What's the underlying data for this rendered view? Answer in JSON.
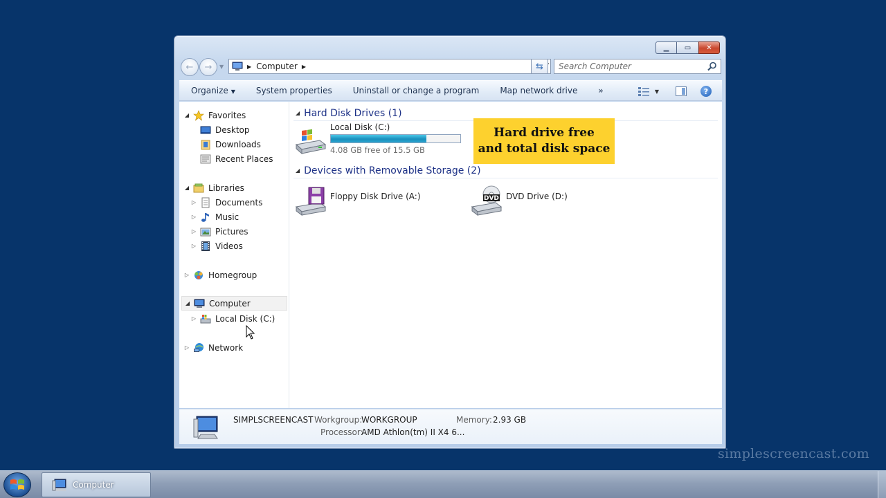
{
  "window": {
    "caption_buttons": [
      "minimize-icon",
      "maximize-icon",
      "close-icon"
    ]
  },
  "navigation": {
    "back_icon": "back-arrow-icon",
    "forward_icon": "forward-arrow-icon",
    "breadcrumb": [
      "Computer"
    ],
    "search_placeholder": "Search Computer"
  },
  "toolbar": {
    "organize_label": "Organize",
    "system_properties_label": "System properties",
    "uninstall_label": "Uninstall or change a program",
    "map_drive_label": "Map network drive",
    "more_label": "»"
  },
  "nav_pane": {
    "favorites": "Favorites",
    "desktop": "Desktop",
    "downloads": "Downloads",
    "recent_places": "Recent Places",
    "libraries": "Libraries",
    "documents": "Documents",
    "music": "Music",
    "pictures": "Pictures",
    "videos": "Videos",
    "homegroup": "Homegroup",
    "computer": "Computer",
    "local_disk": "Local Disk (C:)",
    "network": "Network"
  },
  "main": {
    "hard_disk_group": "Hard Disk Drives (1)",
    "removable_group": "Devices with Removable Storage (2)",
    "local_disk_name": "Local Disk (C:)",
    "local_disk_free": "4.08 GB free of 15.5 GB",
    "local_disk_used_fraction": 0.737,
    "floppy_name": "Floppy Disk Drive (A:)",
    "dvd_name": "DVD Drive (D:)",
    "dvd_badge": "DVD"
  },
  "callout": {
    "line1": "Hard drive free",
    "line2": "and total disk space"
  },
  "details": {
    "computer_name": "SIMPLSCREENCAST",
    "workgroup_label": "Workgroup:",
    "workgroup_value": "WORKGROUP",
    "memory_label": "Memory:",
    "memory_value": "2.93 GB",
    "processor_label": "Processor:",
    "processor_value": "AMD Athlon(tm) II X4 6..."
  },
  "watermark": "simplescreencast.com",
  "taskbar": {
    "task_label": "Computer"
  },
  "colors": {
    "desktop": "#07346a",
    "group_header": "#1e3287",
    "callout": "#fdd12e",
    "capacity_bar": "#1a8fbd"
  }
}
